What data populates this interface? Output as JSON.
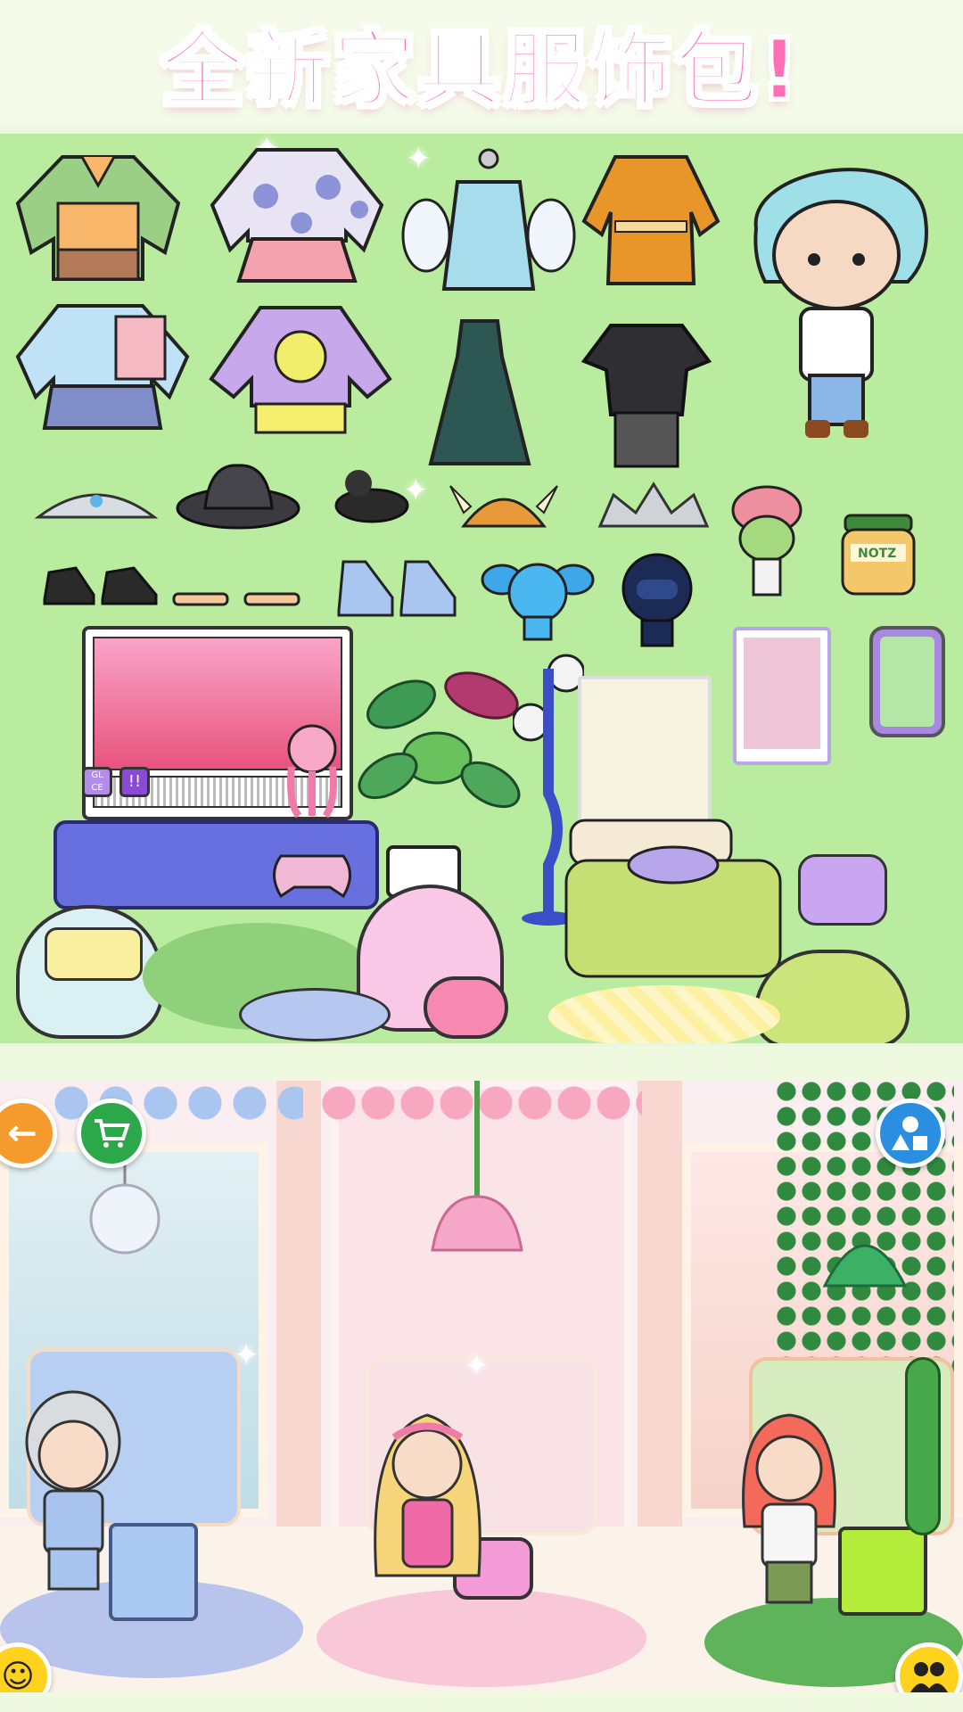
{
  "banner": {
    "title": "全新家具服饰包!"
  },
  "catalog": {
    "background": "#b9ec9f",
    "tv": {
      "label_left": "GL CE",
      "label_right": "!!"
    },
    "jar": {
      "label": "NOTZ"
    }
  },
  "scene": {
    "buttons": {
      "back": {
        "icon": "arrow-left-icon",
        "color": "#f59a2c"
      },
      "shop": {
        "icon": "cart-icon",
        "color": "#2aa84a"
      },
      "shapes": {
        "icon": "shapes-icon",
        "color": "#2a8fe0"
      },
      "emoji": {
        "icon": "face-icon",
        "color": "#ffd21e"
      },
      "people": {
        "icon": "people-icon",
        "color": "#ffd21e"
      }
    }
  }
}
